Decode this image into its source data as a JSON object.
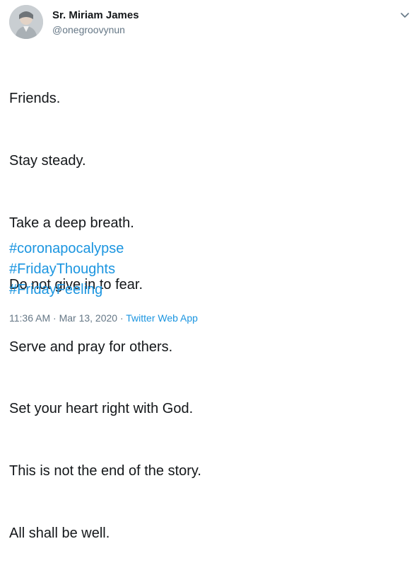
{
  "author": {
    "display_name": "Sr. Miriam James",
    "handle": "@onegroovynun"
  },
  "tweet": {
    "lines": [
      "Friends.",
      "Stay steady.",
      "Take a deep breath.",
      "Do not give in to fear.",
      "Serve and pray for others.",
      "Set your heart right with God.",
      "This is not the end of the story.",
      "All shall be well."
    ],
    "hashtags": [
      "#coronapocalypse",
      "#FridayThoughts",
      "#FridayFeeling"
    ]
  },
  "meta": {
    "time": "11:36 AM",
    "separator": "·",
    "date": "Mar 13, 2020",
    "source": "Twitter Web App"
  },
  "colors": {
    "link": "#1b95e0",
    "secondary_text": "#657786",
    "primary_text": "#14171a"
  },
  "icons": {
    "menu": "chevron-down-icon"
  }
}
